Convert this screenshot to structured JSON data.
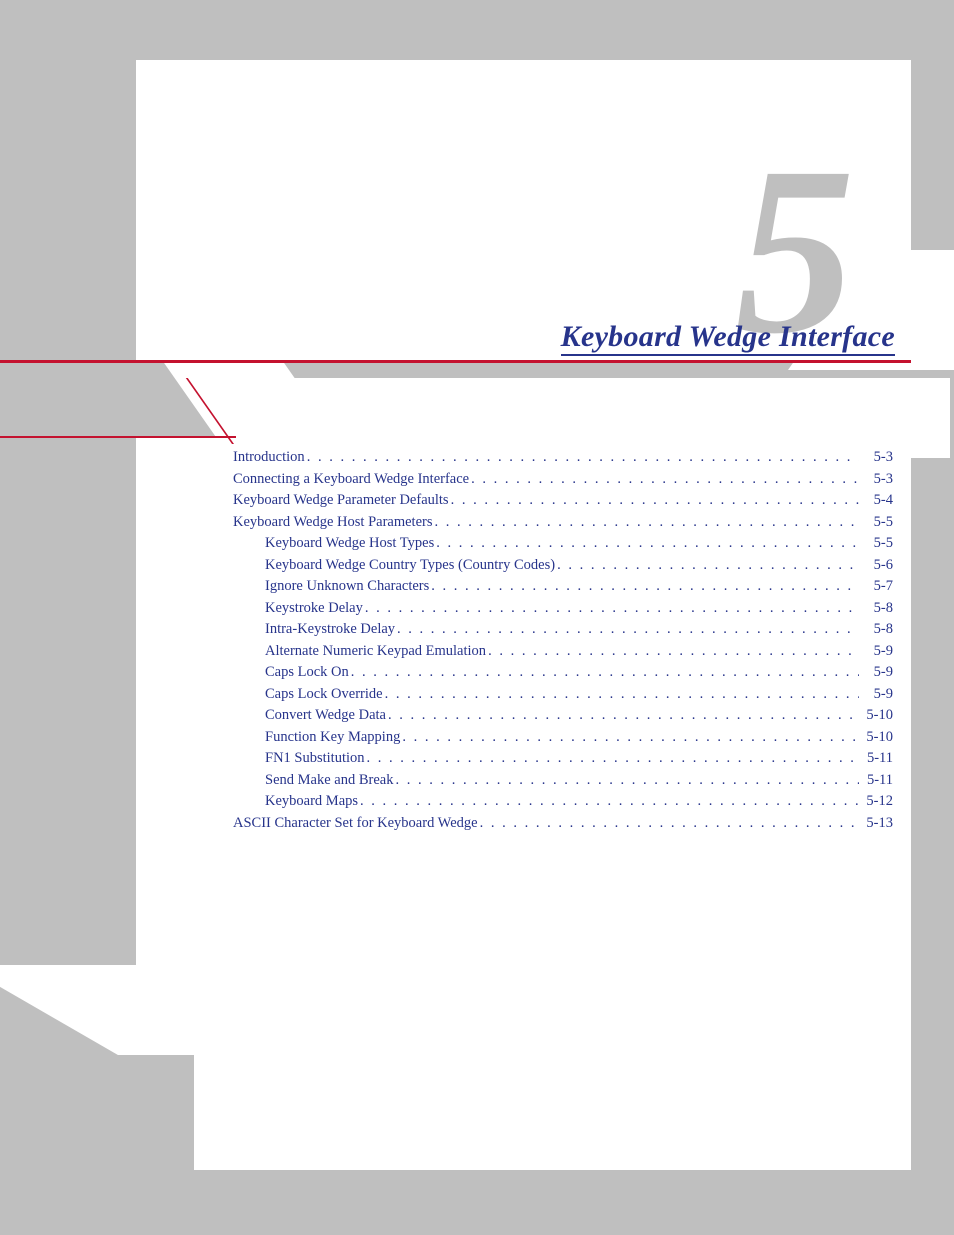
{
  "chapter": {
    "number": "5",
    "title": "Keyboard Wedge Interface"
  },
  "toc": [
    {
      "label": "Introduction",
      "page": "5-3",
      "indent": 0
    },
    {
      "label": "Connecting a Keyboard Wedge Interface",
      "page": "5-3",
      "indent": 0
    },
    {
      "label": "Keyboard Wedge Parameter Defaults",
      "page": "5-4",
      "indent": 0
    },
    {
      "label": "Keyboard Wedge Host Parameters",
      "page": "5-5",
      "indent": 0
    },
    {
      "label": "Keyboard Wedge Host Types",
      "page": "5-5",
      "indent": 1
    },
    {
      "label": "Keyboard Wedge Country Types (Country Codes)",
      "page": "5-6",
      "indent": 1
    },
    {
      "label": "Ignore Unknown Characters",
      "page": "5-7",
      "indent": 1
    },
    {
      "label": "Keystroke Delay",
      "page": "5-8",
      "indent": 1
    },
    {
      "label": "Intra-Keystroke Delay",
      "page": "5-8",
      "indent": 1
    },
    {
      "label": "Alternate Numeric Keypad Emulation",
      "page": "5-9",
      "indent": 1
    },
    {
      "label": "Caps Lock On",
      "page": "5-9",
      "indent": 1
    },
    {
      "label": "Caps Lock Override",
      "page": "5-9",
      "indent": 1
    },
    {
      "label": "Convert Wedge Data",
      "page": "5-10",
      "indent": 1
    },
    {
      "label": "Function Key Mapping",
      "page": "5-10",
      "indent": 1
    },
    {
      "label": "FN1 Substitution",
      "page": "5-11",
      "indent": 1
    },
    {
      "label": "Send Make and Break",
      "page": "5-11",
      "indent": 1
    },
    {
      "label": "Keyboard Maps",
      "page": "5-12",
      "indent": 1
    },
    {
      "label": "ASCII Character Set for Keyboard Wedge",
      "page": "5-13",
      "indent": 0
    }
  ]
}
